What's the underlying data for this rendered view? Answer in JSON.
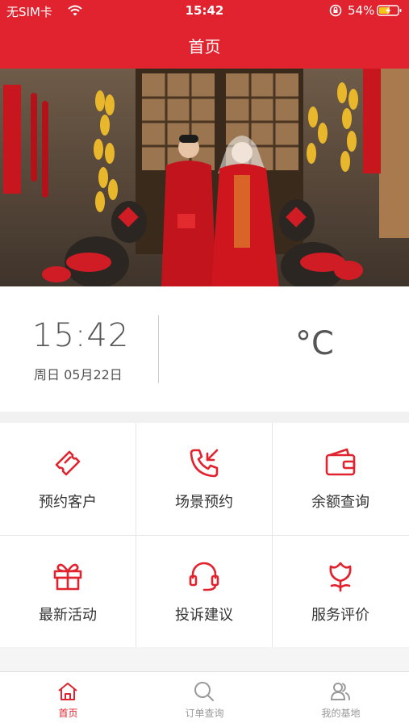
{
  "status_bar": {
    "carrier": "无SIM卡",
    "time": "15:42",
    "battery": "54%"
  },
  "nav": {
    "title": "首页"
  },
  "banner": {
    "slide_count": 6,
    "active_slide": 3
  },
  "info": {
    "time": "15:42",
    "date": "周日 05月22日",
    "temperature_unit": "°C"
  },
  "grid": [
    {
      "label": "预约客户",
      "icon": "ticket-icon"
    },
    {
      "label": "场景预约",
      "icon": "phone-incoming-icon"
    },
    {
      "label": "余额查询",
      "icon": "wallet-icon"
    },
    {
      "label": "最新活动",
      "icon": "gift-icon"
    },
    {
      "label": "投诉建议",
      "icon": "headset-icon"
    },
    {
      "label": "服务评价",
      "icon": "flower-icon"
    }
  ],
  "tabs": [
    {
      "label": "首页",
      "icon": "home-icon",
      "active": true
    },
    {
      "label": "订单查询",
      "icon": "search-icon",
      "active": false
    },
    {
      "label": "我的基地",
      "icon": "users-icon",
      "active": false
    }
  ],
  "colors": {
    "brand": "#e0232e",
    "text": "#333333",
    "muted": "#999999"
  }
}
